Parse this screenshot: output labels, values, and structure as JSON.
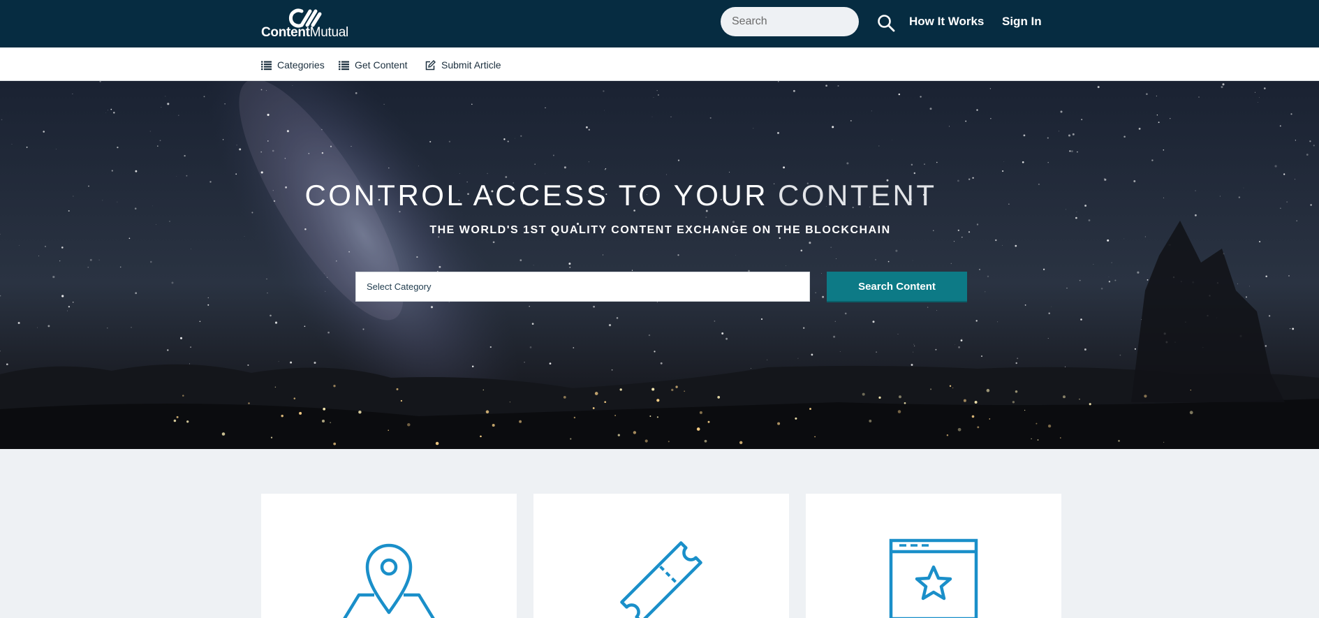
{
  "header": {
    "logo_bold": "Content",
    "logo_light": "Mutual",
    "search_placeholder": "Search",
    "how_it_works": "How It Works",
    "sign_in": "Sign In"
  },
  "subnav": {
    "items": [
      {
        "label": "Categories",
        "icon": "list-icon"
      },
      {
        "label": "Get Content",
        "icon": "list-icon"
      },
      {
        "label": "Submit Article",
        "icon": "edit-icon"
      }
    ]
  },
  "hero": {
    "title_main": "CONTROL ACCESS TO YOUR",
    "title_word": "CONTENT",
    "subtitle": "THE WORLD'S 1ST QUALITY CONTENT EXCHANGE ON THE BLOCKCHAIN",
    "select_placeholder": "Select Category",
    "search_button": "Search Content"
  },
  "cards": [
    {
      "icon": "map-pin-icon"
    },
    {
      "icon": "ticket-icon"
    },
    {
      "icon": "browser-star-icon"
    }
  ],
  "colors": {
    "header_bg": "#062c41",
    "accent_teal": "#0d7a86",
    "icon_blue": "#1a8fc9",
    "page_bg": "#eef1f4"
  }
}
